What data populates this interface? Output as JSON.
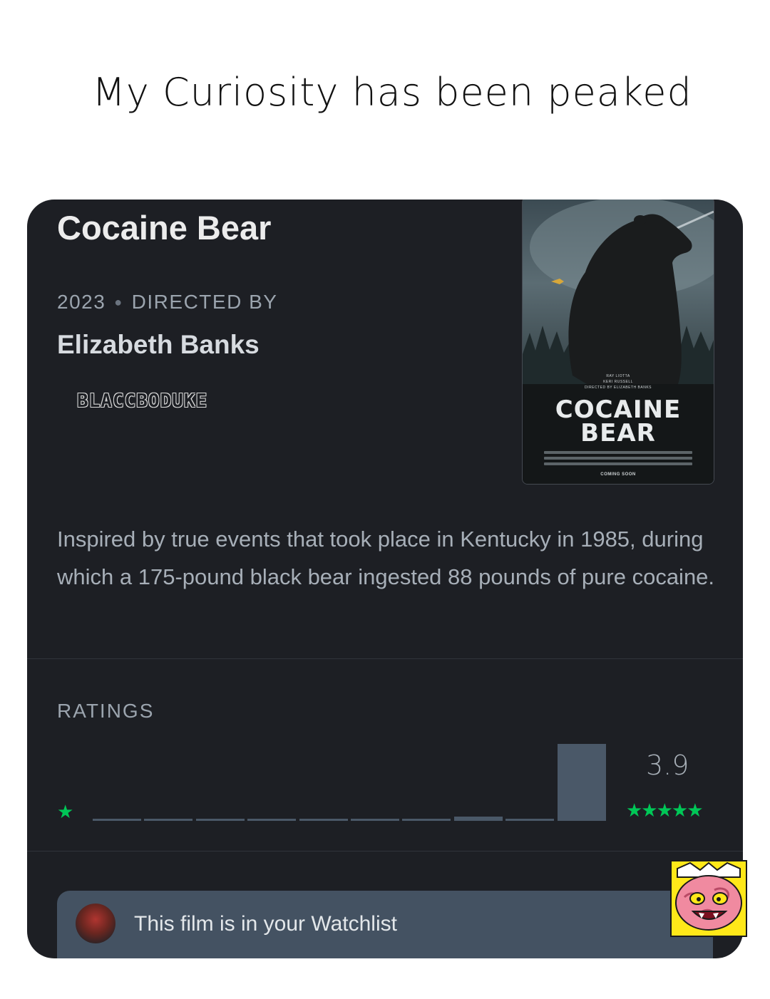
{
  "caption": "My Curiosity has been peaked",
  "film": {
    "title": "Cocaine Bear",
    "year": "2023",
    "directed_by_label": "DIRECTED BY",
    "director": "Elizabeth Banks",
    "synopsis": "Inspired by true events that took place in Kentucky in 1985, during which a 175-pound black bear ingested 88 pounds of pure cocaine."
  },
  "watermark": "BLACCBODUKE",
  "poster": {
    "title_line1": "COCAINE",
    "title_line2": "BEAR",
    "credit_line1": "RAY LIOTTA",
    "credit_line2": "KERI RUSSELL",
    "credit_line3": "DIRECTED BY ELIZABETH BANKS",
    "footer": "COMING SOON"
  },
  "ratings": {
    "label": "RATINGS",
    "average": "3.9",
    "min_icon": "star-icon",
    "max_icon": "five-stars-icon",
    "accent_color": "#00c757",
    "bar_color": "#4a5868",
    "histogram_fraction": [
      0.02,
      0.02,
      0.02,
      0.02,
      0.02,
      0.02,
      0.02,
      0.06,
      0.03,
      1.0
    ]
  },
  "watchlist": {
    "text": "This film is in your Watchlist",
    "icon": "more-icon"
  }
}
